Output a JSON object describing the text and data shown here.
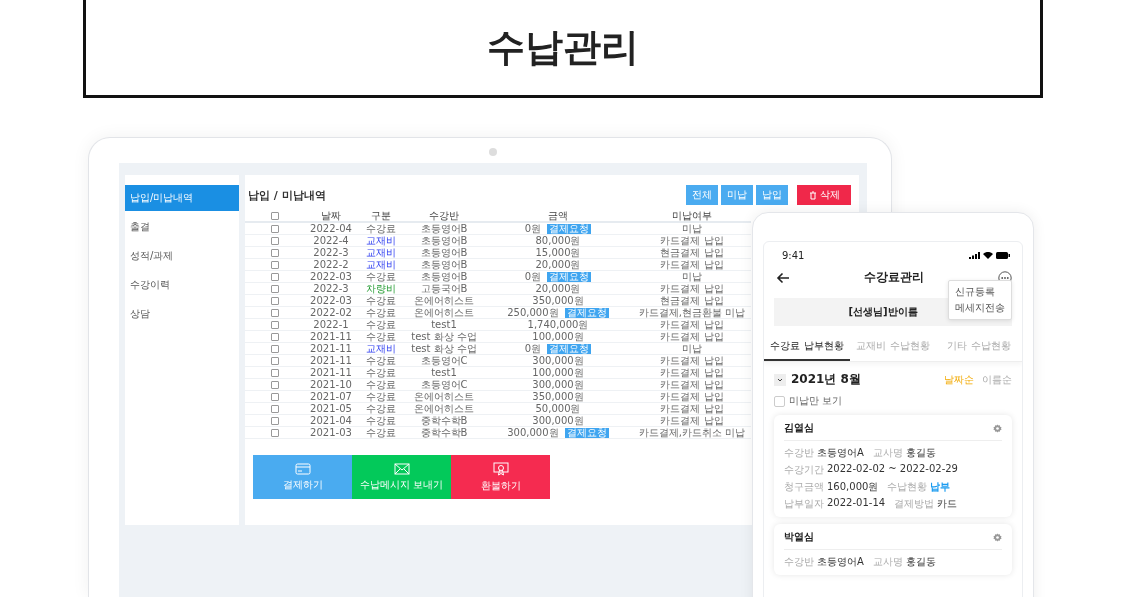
{
  "page_title": "수납관리",
  "laptop": {
    "sidebar": [
      {
        "label": "납입/미납내역",
        "selected": true
      },
      {
        "label": "출결",
        "selected": false
      },
      {
        "label": "성적/과제",
        "selected": false
      },
      {
        "label": "수강이력",
        "selected": false
      },
      {
        "label": "상담",
        "selected": false
      }
    ],
    "heading": "납입 / 미납내역",
    "filter_buttons": [
      "전체",
      "미납",
      "납입"
    ],
    "delete_button": "삭제",
    "table": {
      "select_all_checked": false,
      "columns": [
        "날짜",
        "구분",
        "수강반",
        "금액",
        "미납여부"
      ],
      "rows": [
        {
          "checked": false,
          "date": "2022-04",
          "type": "수강료",
          "kind": "tuition",
          "class": "초등영어B",
          "amount": "0원",
          "badge": "결제요청",
          "status": "미납"
        },
        {
          "checked": false,
          "date": "2022-4",
          "type": "교재비",
          "kind": "textbook",
          "class": "초등영어B",
          "amount": "80,000원",
          "status": "카드결제 납입"
        },
        {
          "checked": false,
          "date": "2022-3",
          "type": "교재비",
          "kind": "textbook",
          "class": "초등영어B",
          "amount": "15,000원",
          "status": "현금결제 납입"
        },
        {
          "checked": false,
          "date": "2022-2",
          "type": "교재비",
          "kind": "textbook",
          "class": "초등영어B",
          "amount": "20,000원",
          "status": "카드결제 납입"
        },
        {
          "checked": false,
          "date": "2022-03",
          "type": "수강료",
          "kind": "tuition",
          "class": "초등영어B",
          "amount": "0원",
          "badge": "결제요청",
          "status": "미납"
        },
        {
          "checked": false,
          "date": "2022-3",
          "type": "차량비",
          "kind": "vehicle",
          "class": "고등국어B",
          "amount": "20,000원",
          "status": "카드결제 납입"
        },
        {
          "checked": false,
          "date": "2022-03",
          "type": "수강료",
          "kind": "tuition",
          "class": "온에어히스트",
          "amount": "350,000원",
          "status": "현금결제 납입"
        },
        {
          "checked": false,
          "date": "2022-02",
          "type": "수강료",
          "kind": "tuition",
          "class": "온에어히스트",
          "amount": "250,000원",
          "badge": "결제요청",
          "status": "카드결제,현금환불 미납"
        },
        {
          "checked": false,
          "date": "2022-1",
          "type": "수강료",
          "kind": "tuition",
          "class": "test1",
          "amount": "1,740,000원",
          "status": "카드결제 납입"
        },
        {
          "checked": false,
          "date": "2021-11",
          "type": "수강료",
          "kind": "tuition",
          "class": "test 화상 수업",
          "amount": "100,000원",
          "status": "카드결제 납입"
        },
        {
          "checked": false,
          "date": "2021-11",
          "type": "교재비",
          "kind": "textbook",
          "class": "test 화상 수업",
          "amount": "0원",
          "badge": "결제요청",
          "status": "미납"
        },
        {
          "checked": false,
          "date": "2021-11",
          "type": "수강료",
          "kind": "tuition",
          "class": "초등영어C",
          "amount": "300,000원",
          "status": "카드결제 납입"
        },
        {
          "checked": false,
          "date": "2021-11",
          "type": "수강료",
          "kind": "tuition",
          "class": "test1",
          "amount": "100,000원",
          "status": "카드결제 납입"
        },
        {
          "checked": false,
          "date": "2021-10",
          "type": "수강료",
          "kind": "tuition",
          "class": "초등영어C",
          "amount": "300,000원",
          "status": "카드결제 납입"
        },
        {
          "checked": false,
          "date": "2021-07",
          "type": "수강료",
          "kind": "tuition",
          "class": "온에어히스트",
          "amount": "350,000원",
          "status": "카드결제 납입"
        },
        {
          "checked": false,
          "date": "2021-05",
          "type": "수강료",
          "kind": "tuition",
          "class": "온에어히스트",
          "amount": "50,000원",
          "status": "카드결제 납입"
        },
        {
          "checked": false,
          "date": "2021-04",
          "type": "수강료",
          "kind": "tuition",
          "class": "중학수학B",
          "amount": "300,000원",
          "status": "카드결제 납입"
        },
        {
          "checked": false,
          "date": "2021-03",
          "type": "수강료",
          "kind": "tuition",
          "class": "중학수학B",
          "amount": "300,000원",
          "badge": "결제요청",
          "status": "카드결제,카드취소 미납"
        }
      ]
    },
    "actions": [
      {
        "kind": "card",
        "label": "결제하기"
      },
      {
        "kind": "mail",
        "label": "수납메시지 보내기"
      },
      {
        "kind": "refund",
        "label": "환불하기"
      }
    ]
  },
  "phone": {
    "time": "9:41",
    "title": "수강료관리",
    "menu": [
      "신규등록",
      "메세지전송"
    ],
    "banner": "[선생님]반이름",
    "tabs": [
      {
        "label": "수강료 납부현황",
        "selected": true
      },
      {
        "label": "교재비 수납현황",
        "selected": false
      },
      {
        "label": "기타 수납현황",
        "selected": false
      }
    ],
    "month": "2021년 8월",
    "sorts": [
      {
        "label": "날짜순",
        "selected": true
      },
      {
        "label": "이름순",
        "selected": false
      }
    ],
    "filter": {
      "label": "미납만 보기",
      "checked": false
    },
    "students": [
      {
        "name": "김열심",
        "fields": [
          {
            "label": "수강반",
            "value": "초등영어A",
            "emphasis": false
          },
          {
            "label": "교사명",
            "value": "홍길동",
            "emphasis": false
          },
          {
            "label": "수강기간",
            "value": "2022-02-02 ~ 2022-02-29",
            "emphasis": false
          },
          {
            "label": "청구금액",
            "value": "160,000원",
            "emphasis": false
          },
          {
            "label": "수납현황",
            "value": "납부",
            "emphasis": true
          },
          {
            "label": "납부일자",
            "value": "2022-01-14",
            "emphasis": false
          },
          {
            "label": "결제방법",
            "value": "카드",
            "emphasis": false
          }
        ]
      },
      {
        "name": "박열심",
        "fields": [
          {
            "label": "수강반",
            "value": "초등영어A",
            "emphasis": false
          },
          {
            "label": "교사명",
            "value": "홍길동",
            "emphasis": false
          }
        ]
      }
    ]
  }
}
